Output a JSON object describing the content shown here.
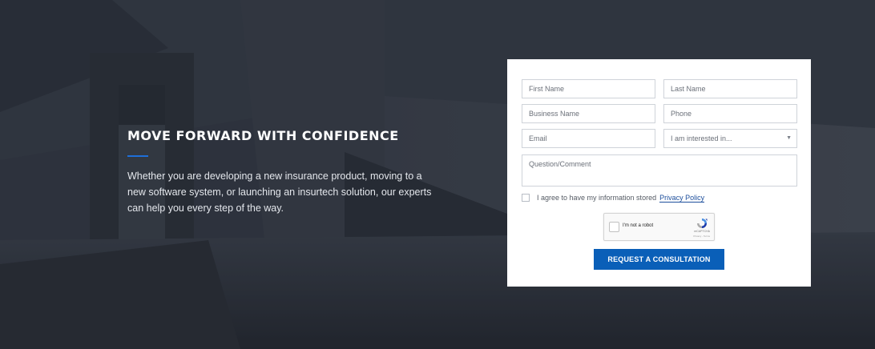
{
  "hero": {
    "heading": "MOVE FORWARD WITH CONFIDENCE",
    "body": "Whether you are developing a new insurance product, moving to a new software system, or launching an insurtech solution, our experts can help you every step of the way."
  },
  "form": {
    "first_name_placeholder": "First Name",
    "last_name_placeholder": "Last Name",
    "business_name_placeholder": "Business Name",
    "phone_placeholder": "Phone",
    "email_placeholder": "Email",
    "interest_select_value": "I am interested in...",
    "comment_placeholder": "Question/Comment",
    "consent_text": "I agree to have my information stored",
    "privacy_link": "Privacy Policy",
    "recaptcha": {
      "label": "I'm not a robot",
      "brand": "reCAPTCHA",
      "terms": "Privacy - Terms"
    },
    "submit_label": "REQUEST A CONSULTATION"
  },
  "colors": {
    "accent": "#1e6fd9",
    "button": "#0a5fb8",
    "background": "#2f3541"
  }
}
